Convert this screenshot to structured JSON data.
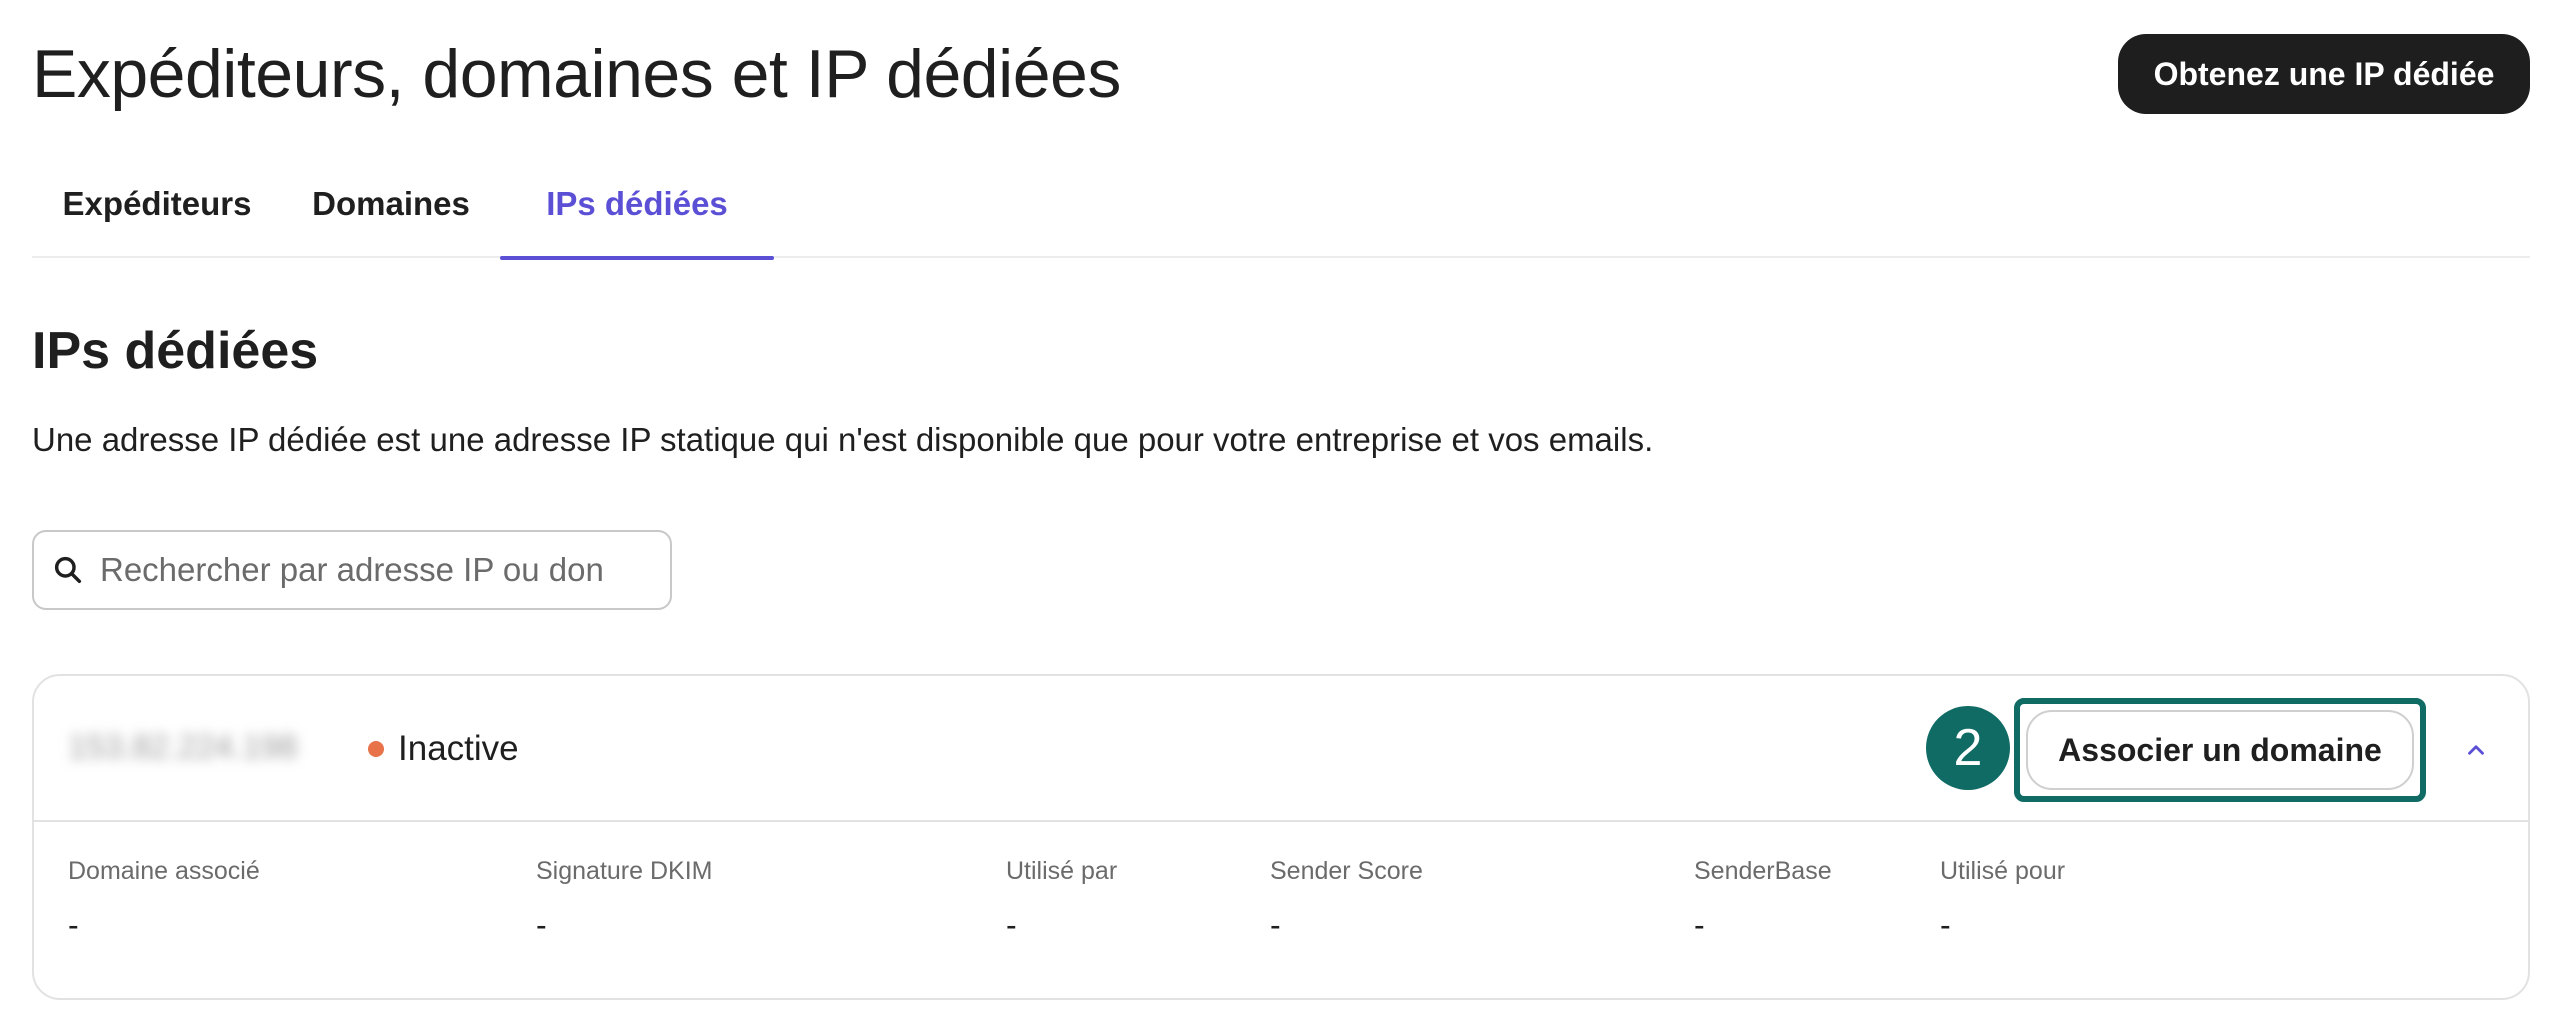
{
  "header": {
    "title": "Expéditeurs, domaines et IP dédiées",
    "primary_button": "Obtenez une IP dédiée"
  },
  "tabs": [
    {
      "label": "Expéditeurs",
      "active": false
    },
    {
      "label": "Domaines",
      "active": false
    },
    {
      "label": "IPs dédiées",
      "active": true
    }
  ],
  "section": {
    "title": "IPs dédiées",
    "description": "Une adresse IP dédiée est une adresse IP statique qui n'est disponible que pour votre entreprise et vos emails."
  },
  "search": {
    "placeholder": "Rechercher par adresse IP ou don",
    "value": ""
  },
  "ip_card": {
    "ip_address": "153.82.224.198",
    "status": "Inactive",
    "status_color": "#e8734a",
    "step_number": "2",
    "associate_button": "Associer un domaine",
    "details": [
      {
        "label": "Domaine associé",
        "value": "-"
      },
      {
        "label": "Signature DKIM",
        "value": "-"
      },
      {
        "label": "Utilisé par",
        "value": "-"
      },
      {
        "label": "Sender Score",
        "value": "-"
      },
      {
        "label": "SenderBase",
        "value": "-"
      },
      {
        "label": "Utilisé pour",
        "value": "-"
      }
    ]
  },
  "colors": {
    "accent": "#5b4fd6",
    "highlight": "#0f6b63",
    "dark_button": "#1e1e1e"
  },
  "icons": [
    "search-icon",
    "chevron-up-icon"
  ]
}
